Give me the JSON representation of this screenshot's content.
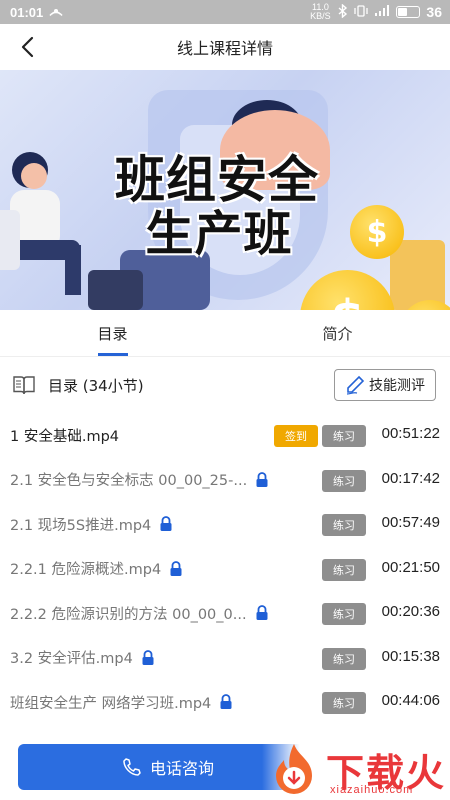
{
  "status_bar": {
    "time": "01:01",
    "net_speed": "11.0 KB/S",
    "battery": "36"
  },
  "nav": {
    "title": "线上课程详情"
  },
  "banner": {
    "line1": "班组安全",
    "line2": "生产班",
    "coin_symbol": "$"
  },
  "tabs": [
    {
      "label": "目录",
      "active": true
    },
    {
      "label": "简介",
      "active": false
    }
  ],
  "catalog": {
    "title": "目录 (34小节)",
    "eval_button": "技能测评"
  },
  "lessons": [
    {
      "title": "1 安全基础.mp4",
      "locked": false,
      "sign_label": "签到",
      "practice_label": "练习",
      "duration": "00:51:22"
    },
    {
      "title": "2.1 安全色与安全标志 00_00_25-...",
      "locked": true,
      "practice_label": "练习",
      "duration": "00:17:42"
    },
    {
      "title": "2.1 现场5S推进.mp4",
      "locked": true,
      "practice_label": "练习",
      "duration": "00:57:49"
    },
    {
      "title": "2.2.1 危险源概述.mp4",
      "locked": true,
      "practice_label": "练习",
      "duration": "00:21:50"
    },
    {
      "title": "2.2.2 危险源识别的方法 00_00_0...",
      "locked": true,
      "practice_label": "练习",
      "duration": "00:20:36"
    },
    {
      "title": "3.2 安全评估.mp4",
      "locked": true,
      "practice_label": "练习",
      "duration": "00:15:38"
    },
    {
      "title": "班组安全生产 网络学习班.mp4",
      "locked": true,
      "practice_label": "练习",
      "duration": "00:44:06"
    }
  ],
  "bottom": {
    "call_label": "电话咨询"
  },
  "watermark": {
    "text": "下载火",
    "url": "xiazaihuo.com"
  },
  "colors": {
    "accent": "#2563d6",
    "sign_badge": "#f0a800",
    "practice_badge": "#8e8e8e",
    "lock": "#1f5fd6"
  }
}
